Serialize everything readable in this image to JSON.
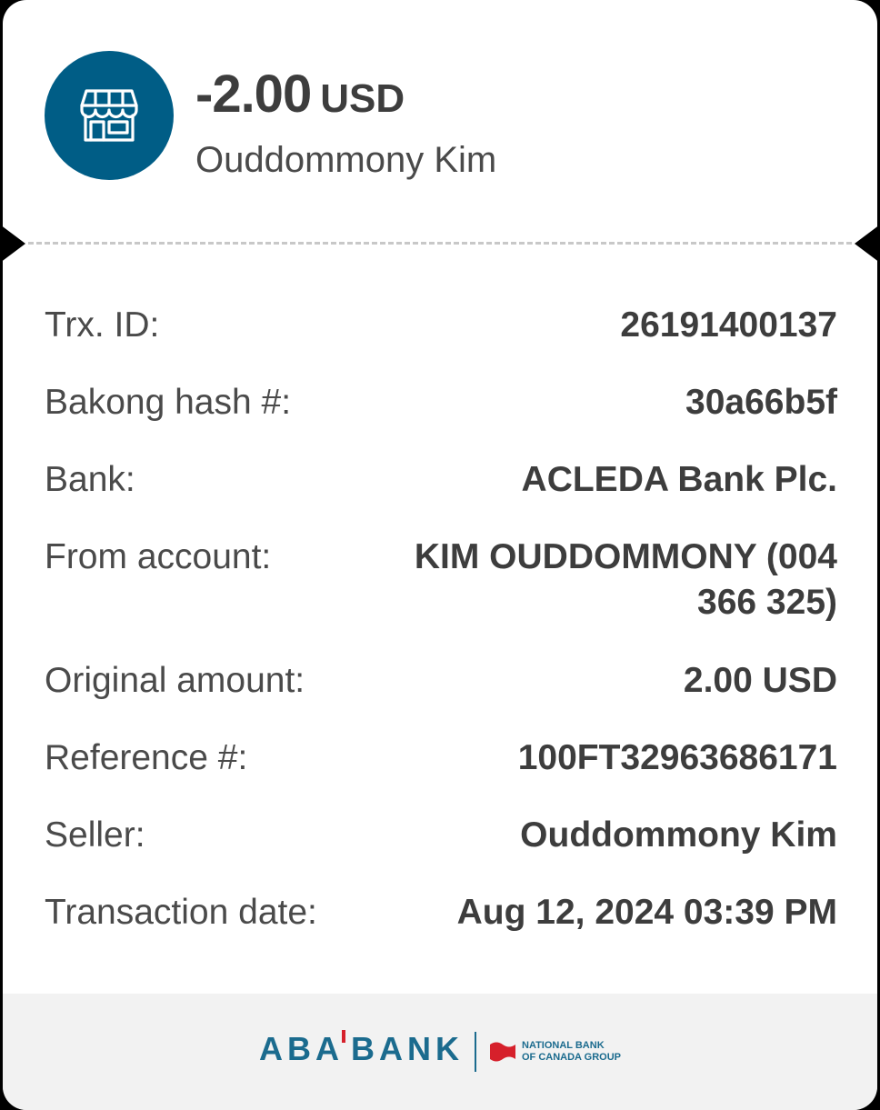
{
  "header": {
    "amount": "-2.00",
    "currency": "USD",
    "merchant_name": "Ouddommony Kim",
    "avatar_icon": "store-icon"
  },
  "details": {
    "trx_id_label": "Trx. ID:",
    "trx_id_value": "26191400137",
    "bakong_hash_label": "Bakong hash #:",
    "bakong_hash_value": "30a66b5f",
    "bank_label": "Bank:",
    "bank_value": "ACLEDA Bank Plc.",
    "from_account_label": "From account:",
    "from_account_value": "KIM OUDDOMMONY (004 366 325)",
    "original_amount_label": "Original amount:",
    "original_amount_value": "2.00 USD",
    "reference_label": "Reference #:",
    "reference_value": "100FT32963686171",
    "seller_label": "Seller:",
    "seller_value": "Ouddommony Kim",
    "transaction_date_label": "Transaction date:",
    "transaction_date_value": "Aug 12, 2024 03:39 PM"
  },
  "footer": {
    "brand_part1": "ABA",
    "brand_part2": "BANK",
    "group_line1": "NATIONAL BANK",
    "group_line2": "OF CANADA GROUP",
    "group_icon": "nbc-flag-icon"
  },
  "colors": {
    "brand_blue": "#005d86",
    "footer_blue": "#1b6b8e",
    "accent_red": "#d6202b",
    "text_dark": "#3d3d3d",
    "footer_bg": "#f2f2f2"
  }
}
